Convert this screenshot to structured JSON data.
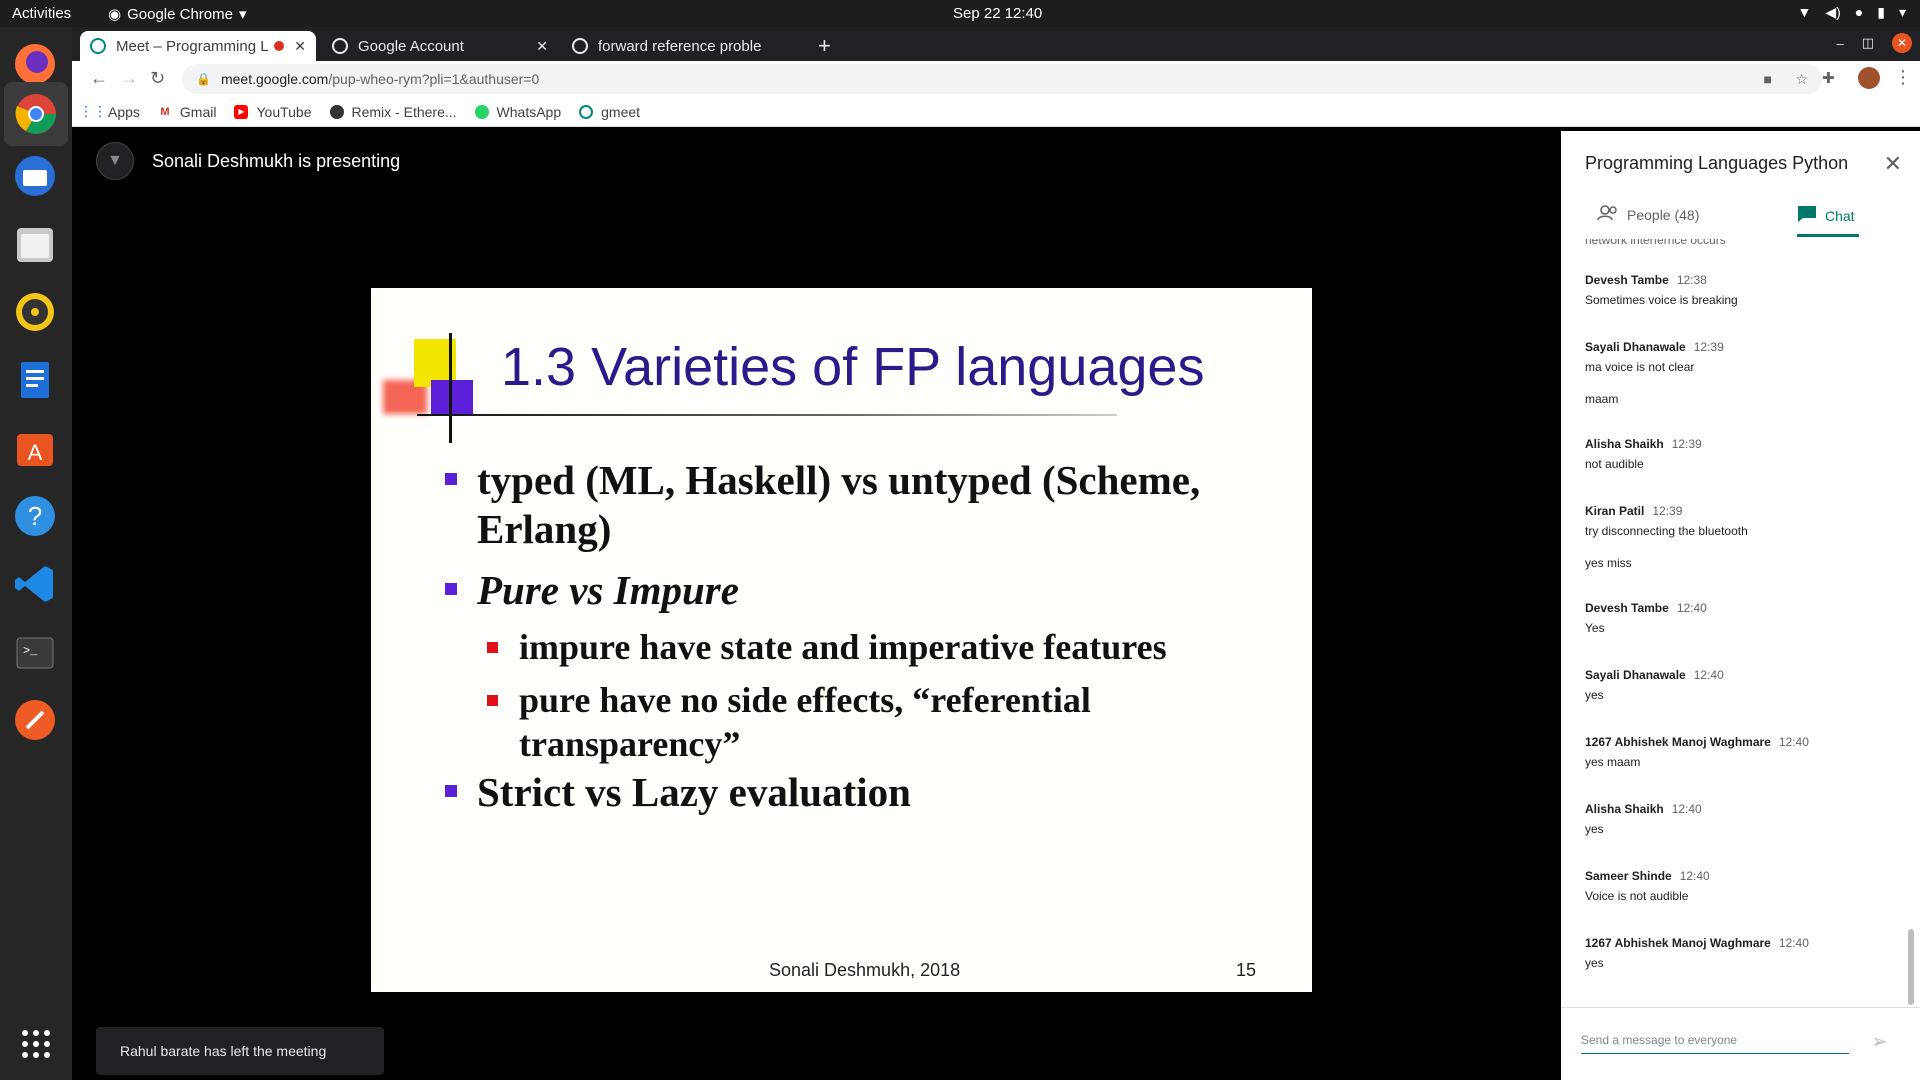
{
  "topbar": {
    "activities": "Activities",
    "app_name": "Google Chrome",
    "clock": "Sep 22  12:40"
  },
  "tabs": [
    {
      "title": "Meet – Programming L",
      "active": true
    },
    {
      "title": "Google Account",
      "active": false
    },
    {
      "title": "forward reference proble",
      "active": false
    }
  ],
  "toolbar": {
    "url_host": "meet.google.com",
    "url_path": "/pup-wheo-rym?pli=1&authuser=0"
  },
  "bookmarks": [
    {
      "label": "Apps",
      "icon": "apps-grid-icon"
    },
    {
      "label": "Gmail",
      "icon": "gmail-icon"
    },
    {
      "label": "YouTube",
      "icon": "youtube-icon"
    },
    {
      "label": "Remix - Ethere...",
      "icon": "remix-icon"
    },
    {
      "label": "WhatsApp",
      "icon": "whatsapp-icon"
    },
    {
      "label": "gmeet",
      "icon": "gmeet-icon"
    }
  ],
  "meet": {
    "presenter_text": "Sonali Deshmukh is presenting",
    "toast": "Rahul barate has left the meeting"
  },
  "slide": {
    "title": "1.3 Varieties of FP languages",
    "bullets": [
      "typed (ML, Haskell) vs untyped (Scheme,",
      "Erlang)",
      "Pure vs Impure",
      "impure have state and imperative features",
      "pure have no side effects, “referential",
      "transparency”",
      "Strict vs Lazy evaluation"
    ],
    "footer": "Sonali Deshmukh, 2018",
    "page": "15"
  },
  "panel": {
    "title": "Programming Languages Python",
    "people_tab": "People (48)",
    "chat_tab": "Chat",
    "composer_placeholder": "Send a message to everyone",
    "partial_top": "network interfernce occurs",
    "messages": [
      {
        "who": "Devesh Tambe",
        "time": "12:38",
        "lines": [
          "Sometimes voice is breaking"
        ]
      },
      {
        "who": "Sayali Dhanawale",
        "time": "12:39",
        "lines": [
          "ma voice is not clear",
          "maam"
        ]
      },
      {
        "who": "Alisha Shaikh",
        "time": "12:39",
        "lines": [
          "not audible"
        ]
      },
      {
        "who": "Kiran Patil",
        "time": "12:39",
        "lines": [
          "try disconnecting the bluetooth",
          "yes miss"
        ]
      },
      {
        "who": "Devesh Tambe",
        "time": "12:40",
        "lines": [
          "Yes"
        ]
      },
      {
        "who": "Sayali Dhanawale",
        "time": "12:40",
        "lines": [
          "yes"
        ]
      },
      {
        "who": "1267 Abhishek Manoj Waghmare",
        "time": "12:40",
        "lines": [
          "yes maam"
        ]
      },
      {
        "who": "Alisha Shaikh",
        "time": "12:40",
        "lines": [
          "yes"
        ]
      },
      {
        "who": "Sameer Shinde",
        "time": "12:40",
        "lines": [
          "Voice is not audible"
        ]
      },
      {
        "who": "1267 Abhishek Manoj Waghmare",
        "time": "12:40",
        "lines": [
          "yes"
        ]
      }
    ]
  },
  "colors": {
    "accent": "#00796b",
    "slide_title": "#2a1a8a",
    "bullet_purple": "#5a1fd6",
    "bullet_red": "#e0101a"
  }
}
